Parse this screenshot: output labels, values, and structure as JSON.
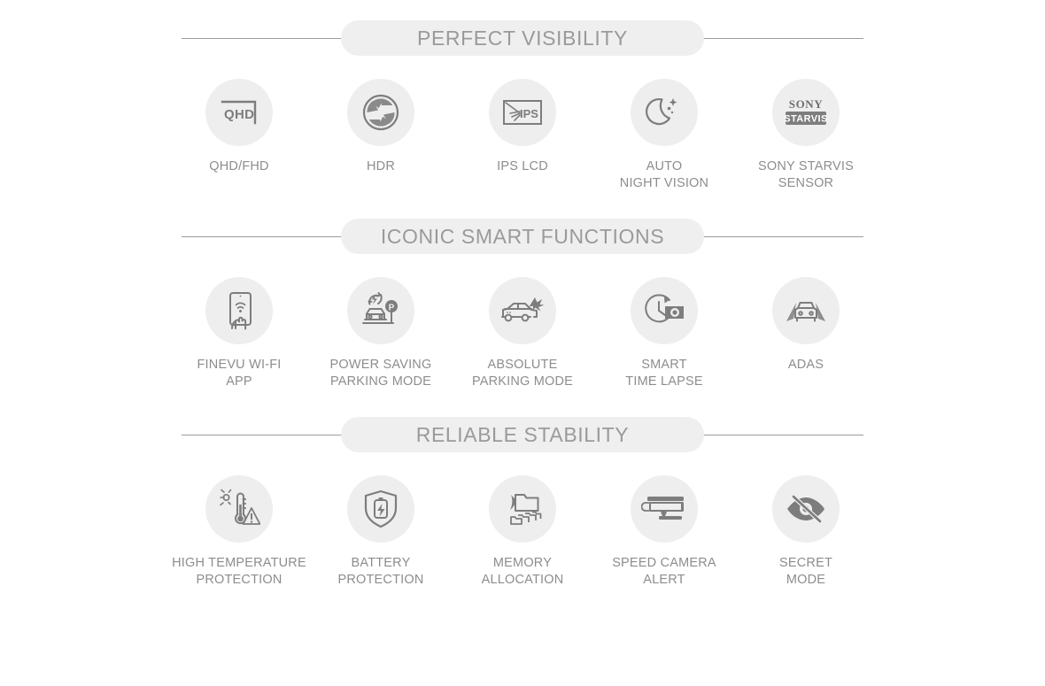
{
  "page": {
    "background": "#ffffff",
    "text_color": "#8d8d8d",
    "pill_color": "#efefef",
    "circle_color": "#eeeeee",
    "icon_color": "#7d7d7d"
  },
  "sections": [
    {
      "title": "PERFECT VISIBILITY",
      "features": [
        {
          "label": "QHD/FHD",
          "icon": "qhd-screen-icon"
        },
        {
          "label": "HDR",
          "icon": "aperture-shutter-icon"
        },
        {
          "label": "IPS LCD",
          "icon": "ips-display-icon"
        },
        {
          "label": "AUTO\nNIGHT VISION",
          "icon": "moon-stars-icon"
        },
        {
          "label": "SONY STARVIS\nSENSOR",
          "icon": "sony-starvis-logo-icon"
        }
      ]
    },
    {
      "title": "ICONIC SMART FUNCTIONS",
      "features": [
        {
          "label": "FINEVU WI-FI\nAPP",
          "icon": "phone-wifi-hand-icon"
        },
        {
          "label": "POWER SAVING\nPARKING MODE",
          "icon": "car-power-parking-icon"
        },
        {
          "label": "ABSOLUTE\nPARKING MODE",
          "icon": "car-impact-icon"
        },
        {
          "label": "SMART\nTIME LAPSE",
          "icon": "clock-camera-icon"
        },
        {
          "label": "ADAS",
          "icon": "car-lane-icon"
        }
      ]
    },
    {
      "title": "RELIABLE STABILITY",
      "features": [
        {
          "label": "HIGH TEMPERATURE\nPROTECTION",
          "icon": "thermometer-warning-icon"
        },
        {
          "label": "BATTERY\nPROTECTION",
          "icon": "shield-battery-icon"
        },
        {
          "label": "MEMORY\nALLOCATION",
          "icon": "folder-files-icon"
        },
        {
          "label": "SPEED CAMERA\nALERT",
          "icon": "speed-camera-icon"
        },
        {
          "label": "SECRET\nMODE",
          "icon": "eye-slash-icon"
        }
      ]
    }
  ],
  "icon_text": {
    "qhd": "QHD",
    "ips": "IPS",
    "sony": "SONY",
    "starvis": "STARVIS",
    "parking_p": "P"
  }
}
